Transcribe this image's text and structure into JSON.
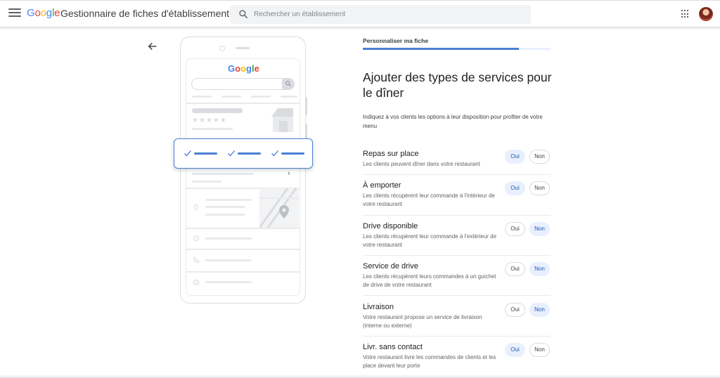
{
  "header": {
    "logo_letters": [
      "G",
      "o",
      "o",
      "g",
      "l",
      "e"
    ],
    "app_title": "Gestionnaire de fiches d'établissement",
    "search_placeholder": "Rechercher un établissement",
    "icons": {
      "menu": "hamburger-icon",
      "search": "search-icon",
      "apps": "apps-grid-icon"
    }
  },
  "illustration": {
    "google_letters": [
      "G",
      "o",
      "o",
      "g",
      "l",
      "e"
    ],
    "stars": "★★★★★"
  },
  "setup": {
    "step_label": "Personnaliser ma fiche",
    "progress_fraction": 0.83,
    "title": "Ajouter des types de services pour le dîner",
    "subtitle": "Indiquez à vos clients les options à leur disposition pour profiter de votre menu",
    "yes_label": "Oui",
    "no_label": "Non",
    "services": [
      {
        "name": "Repas sur place",
        "description": "Les clients peuvent dîner dans votre restaurant",
        "selected": "Oui"
      },
      {
        "name": "À emporter",
        "description": "Les clients récupèrent leur commande à l'intérieur de votre restaurant",
        "selected": "Oui"
      },
      {
        "name": "Drive disponible",
        "description": "Les clients récupèrent leur commande à l'extérieur de votre restaurant",
        "selected": "Non"
      },
      {
        "name": "Service de drive",
        "description": "Les clients récupèrent leurs commandes à un guichet de drive de votre restaurant",
        "selected": "Non"
      },
      {
        "name": "Livraison",
        "description": "Votre restaurant propose un service de livraison (interne ou externe)",
        "selected": "Non"
      },
      {
        "name": "Livr. sans contact",
        "description": "Votre restaurant livre les commandes de clients et les place devant leur porte",
        "selected": "Oui"
      }
    ]
  },
  "colors": {
    "accent": "#4a7fd6",
    "selected_chip_bg": "#e8f0fe",
    "selected_chip_text": "#1a56b0"
  }
}
